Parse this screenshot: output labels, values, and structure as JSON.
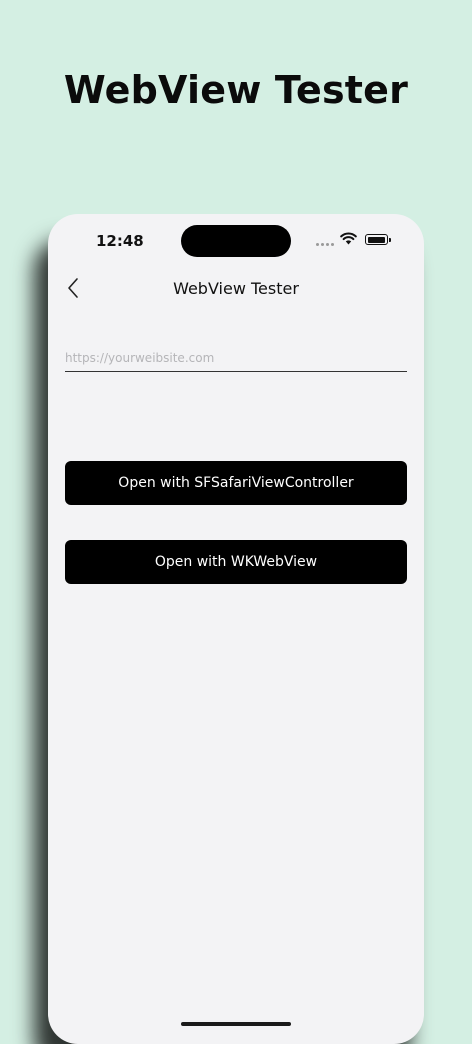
{
  "promo": {
    "title": "WebView Tester"
  },
  "status_bar": {
    "time": "12:48"
  },
  "nav": {
    "title": "WebView Tester",
    "back_icon": "chevron-left-icon"
  },
  "form": {
    "url_placeholder": "https://yourweibsite.com",
    "url_value": "",
    "sfsafari_button_label": "Open with SFSafariViewController",
    "wkwebview_button_label": "Open with WKWebView"
  },
  "colors": {
    "background": "#d4efe3",
    "screen": "#f3f3f5",
    "button": "#000000",
    "button_text": "#ffffff"
  }
}
